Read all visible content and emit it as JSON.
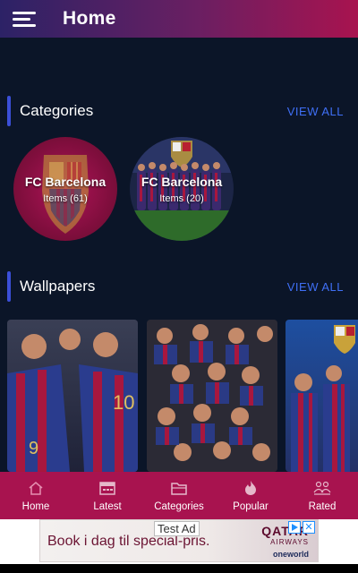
{
  "appbar": {
    "title": "Home",
    "menu_icon": "hamburger-menu-icon"
  },
  "categories": {
    "title": "Categories",
    "view_all": "VIEW ALL",
    "items": [
      {
        "name": "FC Barcelona",
        "count": "Items (61)"
      },
      {
        "name": "FC Barcelona",
        "count": "Items (20)"
      }
    ]
  },
  "wallpapers": {
    "title": "Wallpapers",
    "view_all": "VIEW ALL"
  },
  "bottom_nav": {
    "items": [
      {
        "label": "Home",
        "icon": "home-icon",
        "active": true
      },
      {
        "label": "Latest",
        "icon": "calendar-icon",
        "active": false
      },
      {
        "label": "Categories",
        "icon": "folder-icon",
        "active": false
      },
      {
        "label": "Popular",
        "icon": "flame-icon",
        "active": false
      },
      {
        "label": "Rated",
        "icon": "people-icon",
        "active": false
      }
    ]
  },
  "ad": {
    "label": "Test Ad",
    "text": "Book i dag til special-pris.",
    "brand": "QATAR",
    "brand_sub": "AIRWAYS",
    "alliance": "oneworld"
  },
  "colors": {
    "background": "#0b1528",
    "accent_bar": "#3b4fd8",
    "view_all": "#3f6ff5",
    "bottom_nav": "#a8134f"
  }
}
